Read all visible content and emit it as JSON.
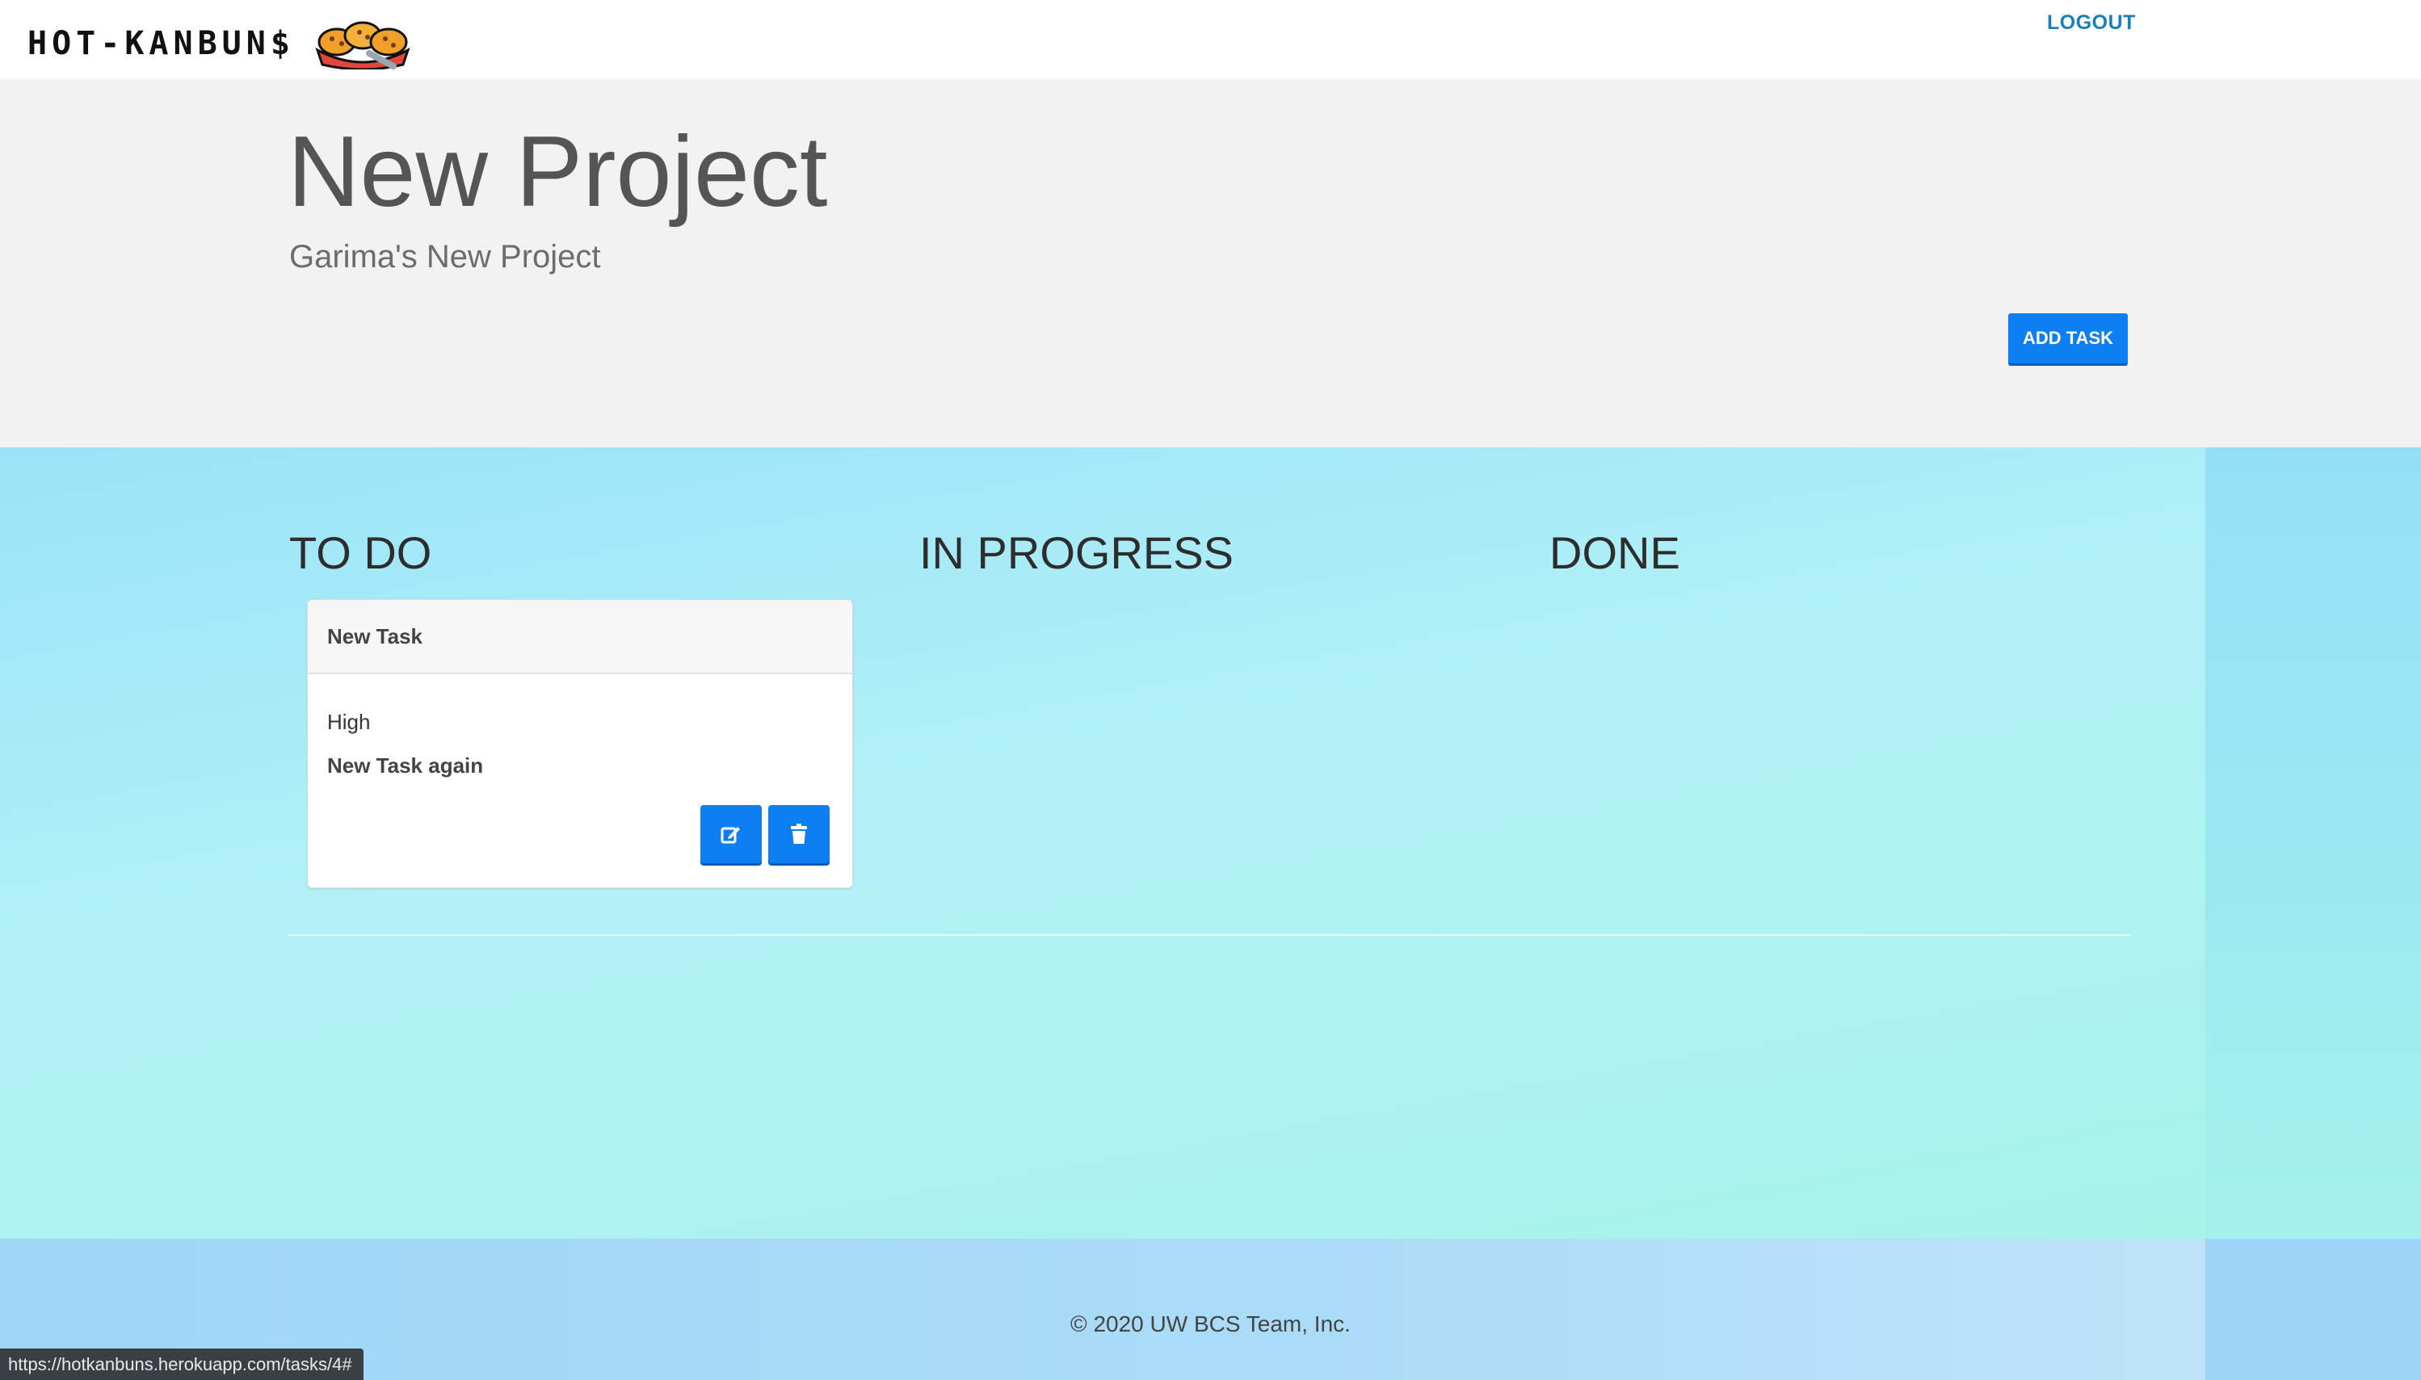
{
  "navbar": {
    "brand_text": "HOT-KANBUN$",
    "logo_icon": "buns-basket-icon",
    "logout_label": "LOGOUT"
  },
  "project": {
    "title": "New Project",
    "description": "Garima's New Project",
    "add_task_label": "ADD TASK"
  },
  "columns": [
    {
      "title": "TO DO"
    },
    {
      "title": "IN PROGRESS"
    },
    {
      "title": "DONE"
    }
  ],
  "tasks": [
    {
      "title": "New Task",
      "priority": "High",
      "description": "New Task again",
      "edit_icon": "edit-icon",
      "delete_icon": "trash-icon"
    }
  ],
  "footer": {
    "copyright": "© 2020 UW BCS Team, Inc."
  },
  "status_bar": {
    "url": "https://hotkanbuns.herokuapp.com/tasks/4#"
  },
  "colors": {
    "primary_button": "#0d7ff0",
    "link": "#1a7fb5",
    "hero_bg": "#f2f2f2"
  }
}
